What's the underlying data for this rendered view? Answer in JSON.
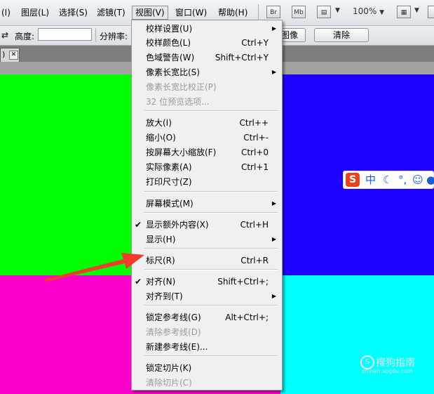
{
  "menubar": {
    "items": [
      "(I)",
      "图层(L)",
      "选择(S)",
      "滤镜(T)",
      "视图(V)",
      "窗口(W)",
      "帮助(H)"
    ],
    "toolbar_icons": [
      "Br",
      "Mb"
    ],
    "zoom": "100%"
  },
  "options": {
    "height_label": "高度:",
    "height_value": "",
    "resolution_label": "分辨率:",
    "image_button": "图像",
    "clear_button": "清除"
  },
  "doc_tab": {
    "label": ")"
  },
  "colors": {
    "top_left": "#00ff00",
    "top_right": "#1e00ff",
    "bottom_left": "#ff00cc",
    "bottom_right": "#00ffff",
    "arrow": "#f03c2d"
  },
  "view_menu": {
    "items": [
      {
        "label": "校样设置(U)",
        "shortcut": "",
        "submenu": true
      },
      {
        "label": "校样颜色(L)",
        "shortcut": "Ctrl+Y"
      },
      {
        "label": "色域警告(W)",
        "shortcut": "Shift+Ctrl+Y"
      },
      {
        "label": "像素长宽比(S)",
        "shortcut": "",
        "submenu": true
      },
      {
        "label": "像素长宽比校正(P)",
        "shortcut": "",
        "disabled": true
      },
      {
        "label": "32 位预览选项...",
        "shortcut": "",
        "disabled": true
      },
      {
        "label": "放大(I)",
        "shortcut": "Ctrl++"
      },
      {
        "label": "缩小(O)",
        "shortcut": "Ctrl+-"
      },
      {
        "label": "按屏幕大小缩放(F)",
        "shortcut": "Ctrl+0"
      },
      {
        "label": "实际像素(A)",
        "shortcut": "Ctrl+1"
      },
      {
        "label": "打印尺寸(Z)",
        "shortcut": ""
      },
      {
        "label": "屏幕模式(M)",
        "shortcut": "",
        "submenu": true
      },
      {
        "label": "显示额外内容(X)",
        "shortcut": "Ctrl+H",
        "checked": true
      },
      {
        "label": "显示(H)",
        "shortcut": "",
        "submenu": true
      },
      {
        "label": "标尺(R)",
        "shortcut": "Ctrl+R"
      },
      {
        "label": "对齐(N)",
        "shortcut": "Shift+Ctrl+;",
        "checked": true
      },
      {
        "label": "对齐到(T)",
        "shortcut": "",
        "submenu": true
      },
      {
        "label": "锁定参考线(G)",
        "shortcut": "Alt+Ctrl+;"
      },
      {
        "label": "清除参考线(D)",
        "shortcut": "",
        "disabled": true
      },
      {
        "label": "新建参考线(E)...",
        "shortcut": ""
      },
      {
        "label": "锁定切片(K)",
        "shortcut": ""
      },
      {
        "label": "清除切片(C)",
        "shortcut": "",
        "disabled": true
      }
    ]
  },
  "ime": {
    "logo": "S",
    "lang": "中"
  },
  "watermark": {
    "title": "搜狗指南",
    "url": "zhinan.sogou.com"
  }
}
